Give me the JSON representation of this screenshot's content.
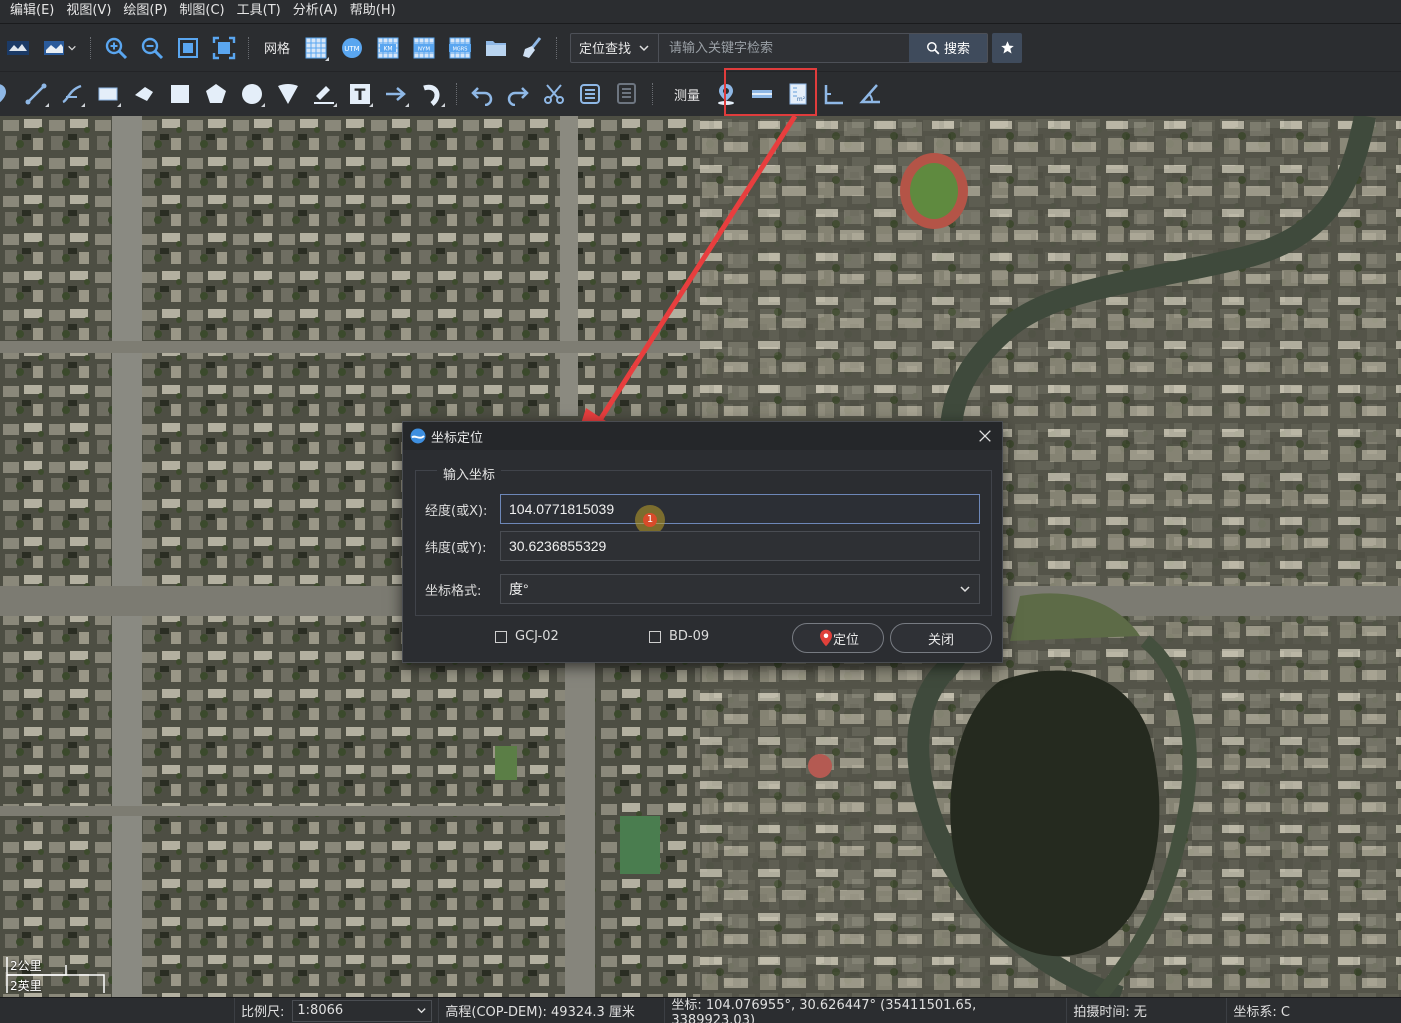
{
  "menu": [
    "编辑(E)",
    "视图(V)",
    "绘图(P)",
    "制图(C)",
    "工具(T)",
    "分析(A)",
    "帮助(H)"
  ],
  "toolbar1": {
    "grid_label": "网格",
    "search_mode": "定位查找",
    "search_placeholder": "请输入关键字检索",
    "search_button": "搜索",
    "map_icon_labels": [
      "UTM",
      "KM",
      "NYM",
      "MGRS"
    ]
  },
  "toolbar2": {
    "measure_label": "测量"
  },
  "dialog": {
    "title": "坐标定位",
    "group_title": "输入坐标",
    "lon_label": "经度(或X):",
    "lon_value": "104.0771815039",
    "lat_label": "纬度(或Y):",
    "lat_value": "30.6236855329",
    "format_label": "坐标格式:",
    "format_value": "度°",
    "gcj_label": "GCJ-02",
    "bd_label": "BD-09",
    "locate_button": "定位",
    "close_button": "关闭",
    "cursor_marker": "1"
  },
  "scalebar": {
    "metric": "2公里",
    "imperial": "2英里"
  },
  "status": {
    "scale_label": "比例尺:",
    "scale_value": "1:8066",
    "elevation": "高程(COP-DEM): 49324.3 厘米",
    "coords": "坐标: 104.076955°, 30.626447°  (35411501.65, 3389923.03)",
    "capture_time": "拍摄时间: 无",
    "crs": "坐标系: C"
  },
  "colors": {
    "accent_red": "#e03c3c",
    "panel_bg": "#2b2d30",
    "button_blue": "#3f4b5c",
    "locate_pin": "#e0403a"
  }
}
